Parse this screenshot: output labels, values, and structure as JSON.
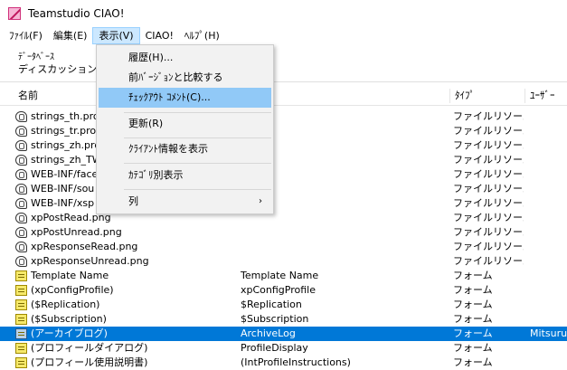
{
  "window": {
    "title": "Teamstudio CIAO!"
  },
  "menubar": {
    "items": [
      {
        "label": "ﾌｧｲﾙ(F)"
      },
      {
        "label": "編集(E)"
      },
      {
        "label": "表示(V)"
      },
      {
        "label": "CIAO!"
      },
      {
        "label": "ﾍﾙﾌﾟ(H)"
      }
    ]
  },
  "breadcrumb": {
    "line1": "ﾃﾞｰﾀﾍﾞｰｽ",
    "line2": "ディスカッション / L"
  },
  "table": {
    "headers": {
      "name": "名前",
      "type": "ﾀｲﾌﾟ",
      "user": "ﾕｰｻﾞｰ"
    },
    "rows": [
      {
        "icon": "resource-icon",
        "name": "strings_th.prop",
        "alias": "",
        "type": "ファイルリソース",
        "user": ""
      },
      {
        "icon": "resource-icon",
        "name": "strings_tr.prop",
        "alias": "",
        "type": "ファイルリソース",
        "user": ""
      },
      {
        "icon": "resource-icon",
        "name": "strings_zh.prop",
        "alias": "",
        "type": "ファイルリソース",
        "user": ""
      },
      {
        "icon": "resource-icon",
        "name": "strings_zh_TW.",
        "alias": "",
        "type": "ファイルリソース",
        "user": ""
      },
      {
        "icon": "resource-icon",
        "name": "WEB-INF/face",
        "alias": "",
        "type": "ファイルリソース",
        "user": ""
      },
      {
        "icon": "resource-icon",
        "name": "WEB-INF/sou",
        "alias": "",
        "type": "ファイルリソース",
        "user": ""
      },
      {
        "icon": "resource-icon",
        "name": "WEB-INF/xsp",
        "alias": "",
        "type": "ファイルリソース",
        "user": ""
      },
      {
        "icon": "resource-icon",
        "name": "xpPostRead.png",
        "alias": "",
        "type": "ファイルリソース",
        "user": ""
      },
      {
        "icon": "resource-icon",
        "name": "xpPostUnread.png",
        "alias": "",
        "type": "ファイルリソース",
        "user": ""
      },
      {
        "icon": "resource-icon",
        "name": "xpResponseRead.png",
        "alias": "",
        "type": "ファイルリソース",
        "user": ""
      },
      {
        "icon": "resource-icon",
        "name": "xpResponseUnread.png",
        "alias": "",
        "type": "ファイルリソース",
        "user": ""
      },
      {
        "icon": "form-icon",
        "name": "Template Name",
        "alias": "Template Name",
        "type": "フォーム",
        "user": ""
      },
      {
        "icon": "form-icon",
        "name": "(xpConfigProfile)",
        "alias": "xpConfigProfile",
        "type": "フォーム",
        "user": ""
      },
      {
        "icon": "form-icon",
        "name": "($Replication)",
        "alias": "$Replication",
        "type": "フォーム",
        "user": ""
      },
      {
        "icon": "form-icon",
        "name": "($Subscription)",
        "alias": "$Subscription",
        "type": "フォーム",
        "user": ""
      },
      {
        "icon": "form-icon",
        "name": "(アーカイブログ)",
        "alias": "ArchiveLog",
        "type": "フォーム",
        "user": "Mitsuru",
        "selected": true
      },
      {
        "icon": "form-icon",
        "name": "(プロフィールダイアログ)",
        "alias": "ProfileDisplay",
        "type": "フォーム",
        "user": ""
      },
      {
        "icon": "form-icon",
        "name": "(プロフィール使用説明書)",
        "alias": "(IntProfileInstructions)",
        "type": "フォーム",
        "user": ""
      }
    ]
  },
  "view_menu": {
    "items": [
      {
        "label": "履歴(H)..."
      },
      {
        "label": "前ﾊﾞｰｼﾞｮﾝと比較する"
      },
      {
        "label": "ﾁｪｯｸｱｳﾄ ｺﾒﾝﾄ(C)...",
        "highlighted": true
      },
      {
        "label": "更新(R)"
      },
      {
        "label": "ｸﾗｲｱﾝﾄ情報を表示"
      },
      {
        "label": "ｶﾃｺﾞﾘ別表示"
      },
      {
        "label": "列",
        "submenu_arrow": "›"
      }
    ]
  }
}
